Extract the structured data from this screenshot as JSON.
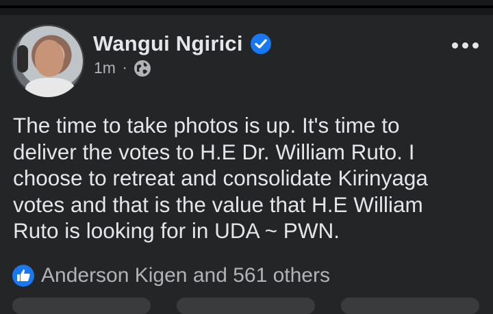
{
  "post": {
    "author": "Wangui Ngirici",
    "timestamp": "1m",
    "separator": "·",
    "privacy_icon": "globe-icon",
    "verified_icon": "verified-badge-icon",
    "more_icon": "more-options-icon",
    "text": "The time to take photos is up. It's time to\ndeliver the votes to H.E Dr. William Ruto. I\nchoose to retreat and consolidate Kirinyaga\nvotes and that is the value that H.E William\nRuto is looking for in UDA ~ PWN.",
    "reaction_icon": "like-icon",
    "reaction_summary": "Anderson Kigen and 561 others"
  },
  "colors": {
    "background": "#242526",
    "text_primary": "#e4e6eb",
    "text_secondary": "#b0b3b8",
    "accent": "#1877f2"
  }
}
